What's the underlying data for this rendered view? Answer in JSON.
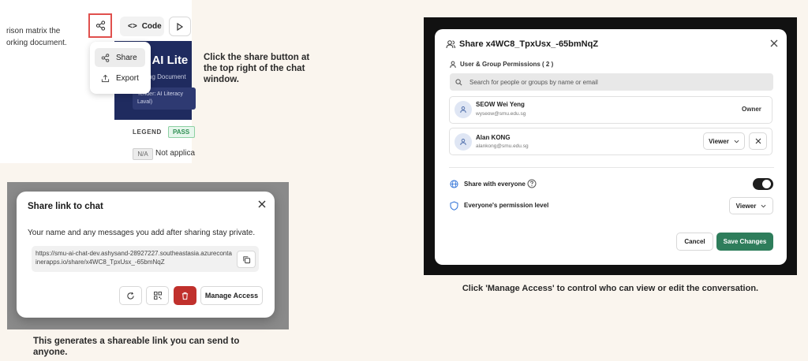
{
  "panel1": {
    "chat_text_line1": "rison matrix the",
    "chat_text_line2": "orking document.",
    "code_tab_label": "Code",
    "header_title": "U AI Lite",
    "header_subtitle": "ng Document",
    "tender_line1": "Tender: AI Literacy",
    "tender_line2": "Laval)",
    "legend_label": "LEGEND",
    "pass_badge": "PASS",
    "na_badge": "N/A",
    "na_text": "Not applica",
    "menu": {
      "share_label": "Share",
      "export_label": "Export"
    },
    "caption": "Click the share button at the top right of the chat window."
  },
  "panel2": {
    "dialog_title": "Share link to chat",
    "description": "Your name and any messages you add after sharing stay private.",
    "share_url": "https://smu-ai-chat-dev.ashysand-28927227.southeastasia.azurecontainerapps.io/share/x4WC8_TpxUsx_-65bmNqZ",
    "manage_access_label": "Manage Access",
    "caption": "This generates a shareable link you can send to anyone."
  },
  "panel3": {
    "dialog_title": "Share x4WC8_TpxUsx_-65bmNqZ",
    "permissions_label": "User & Group Permissions ( 2 )",
    "search_placeholder": "Search for people or groups by name or email",
    "users": [
      {
        "name": "SEOW Wei Yeng",
        "email": "wyseow@smu.edu.sg",
        "role": "Owner"
      },
      {
        "name": "Alan KONG",
        "email": "alankong@smu.edu.sg",
        "role": "Viewer"
      }
    ],
    "share_everyone_label": "Share with everyone",
    "share_everyone_on": true,
    "everyone_permission_label": "Everyone's permission level",
    "everyone_permission_value": "Viewer",
    "cancel_label": "Cancel",
    "save_label": "Save Changes",
    "caption": "Click 'Manage Access' to control who can view or edit the conversation."
  },
  "colors": {
    "background": "#faf5ee",
    "highlight_border": "#e0504d",
    "header_navy": "#1f2b5f",
    "delete_red": "#c0302c",
    "save_green": "#2e7d5b"
  }
}
